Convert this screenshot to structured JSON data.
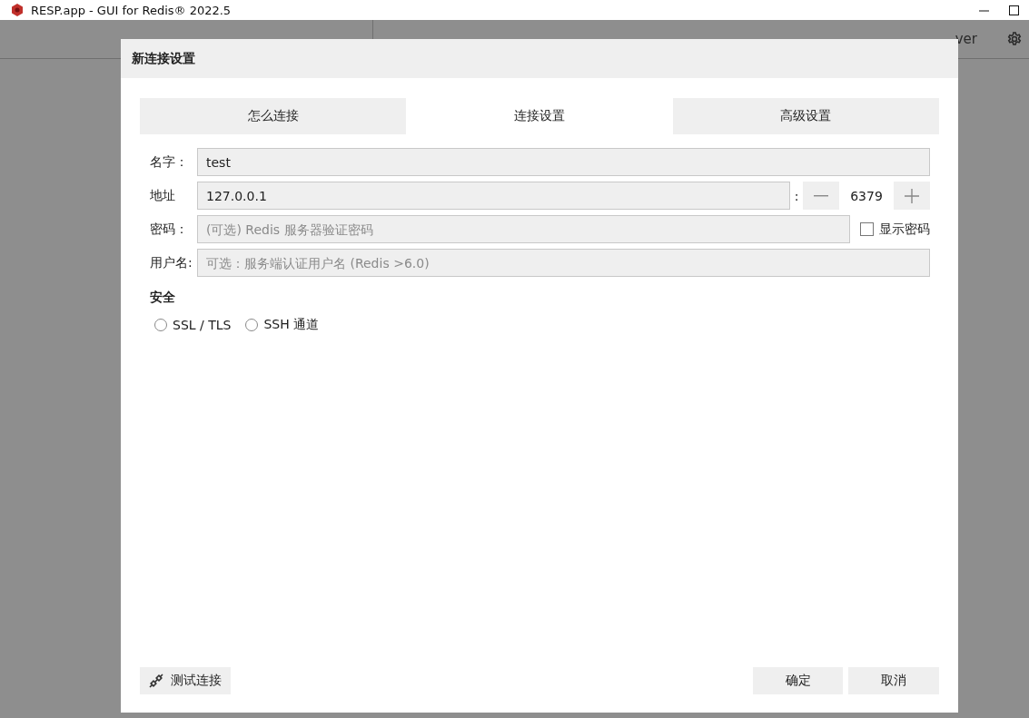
{
  "window": {
    "title": "RESP.app - GUI for Redis® 2022.5"
  },
  "toolbar": {
    "extension_button": "ver"
  },
  "dialog": {
    "title": "新连接设置",
    "tabs": [
      {
        "label": "怎么连接",
        "selected": false
      },
      {
        "label": "连接设置",
        "selected": true
      },
      {
        "label": "高级设置",
        "selected": false
      }
    ],
    "fields": [
      {
        "kind": "text",
        "label": "名字：",
        "value": "test"
      },
      {
        "kind": "address",
        "label": "地址",
        "value": "127.0.0.1",
        "separator": ":",
        "port": "6379"
      },
      {
        "kind": "password",
        "label": "密码：",
        "placeholder": "(可选) Redis 服务器验证密码",
        "toggle": {
          "label": "显示密码",
          "checked": false
        }
      },
      {
        "kind": "text",
        "label": "用户名:",
        "placeholder": "可选：服务端认证用户名 (Redis >6.0)"
      }
    ],
    "security": {
      "title": "安全",
      "options": [
        {
          "label": "SSL / TLS",
          "selected": false
        },
        {
          "label": "SSH 通道",
          "selected": false
        }
      ]
    },
    "buttons": {
      "test": "测试连接",
      "ok": "确定",
      "cancel": "取消"
    }
  }
}
